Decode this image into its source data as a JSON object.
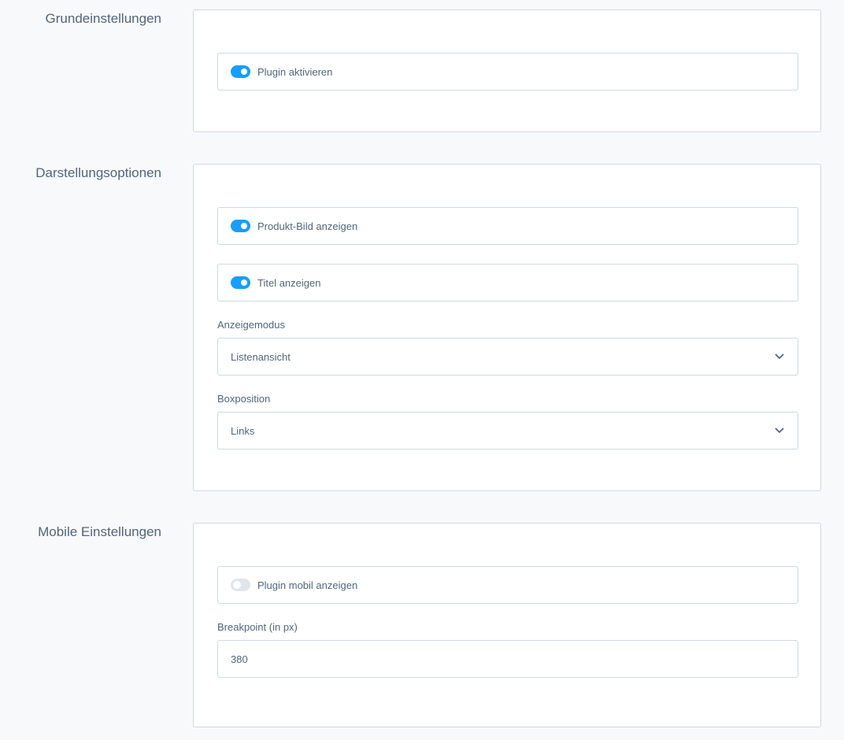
{
  "sections": {
    "basic": {
      "title": "Grundeinstellungen",
      "plugin_active": {
        "label": "Plugin aktivieren",
        "checked": true
      }
    },
    "display": {
      "title": "Darstellungsoptionen",
      "show_image": {
        "label": "Produkt-Bild anzeigen",
        "checked": true
      },
      "show_title": {
        "label": "Titel anzeigen",
        "checked": true
      },
      "display_mode": {
        "label": "Anzeigemodus",
        "value": "Listenansicht"
      },
      "box_position": {
        "label": "Boxposition",
        "value": "Links"
      }
    },
    "mobile": {
      "title": "Mobile Einstellungen",
      "show_mobile": {
        "label": "Plugin mobil anzeigen",
        "checked": false
      },
      "breakpoint": {
        "label": "Breakpoint (in px)",
        "value": "380"
      }
    }
  },
  "colors": {
    "accent": "#189eff",
    "toggle_off": "#e0e6eb",
    "border": "#d1d9e0",
    "text": "#52667a",
    "background": "#f8f9fb"
  },
  "icons": {
    "select_chevron": "chevron-down-icon"
  }
}
